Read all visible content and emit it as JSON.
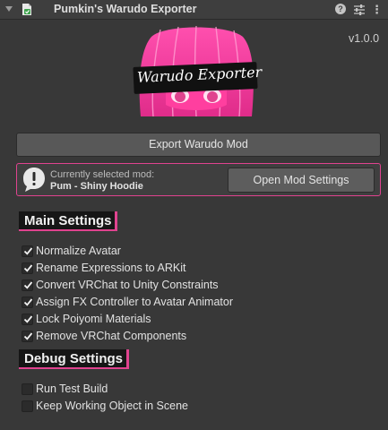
{
  "header": {
    "title": "Pumkin's Warudo Exporter",
    "fold_icon": "triangle-down-icon",
    "component_icon": "script-component-icon",
    "help_icon": "help-icon",
    "preset_icon": "sliders-icon",
    "more_icon": "kebab-menu-icon"
  },
  "version": "v1.0.0",
  "logo": {
    "banner_text": "Warudo Exporter",
    "accent_color": "#e0438f"
  },
  "export_button": "Export Warudo Mod",
  "mod_box": {
    "icon": "warning-icon",
    "label": "Currently selected mod:",
    "value": "Pum - Shiny Hoodie",
    "settings_button": "Open Mod Settings"
  },
  "main_settings": {
    "heading": "Main Settings",
    "options": [
      {
        "label": "Normalize Avatar",
        "checked": true
      },
      {
        "label": "Rename Expressions to ARKit",
        "checked": true
      },
      {
        "label": "Convert VRChat to Unity Constraints",
        "checked": true
      },
      {
        "label": "Assign FX Controller to Avatar Animator",
        "checked": true
      },
      {
        "label": "Lock Poiyomi Materials",
        "checked": true
      },
      {
        "label": "Remove VRChat Components",
        "checked": true
      }
    ]
  },
  "debug_settings": {
    "heading": "Debug Settings",
    "options": [
      {
        "label": "Run Test Build",
        "checked": false
      },
      {
        "label": "Keep Working Object in Scene",
        "checked": false
      }
    ]
  }
}
